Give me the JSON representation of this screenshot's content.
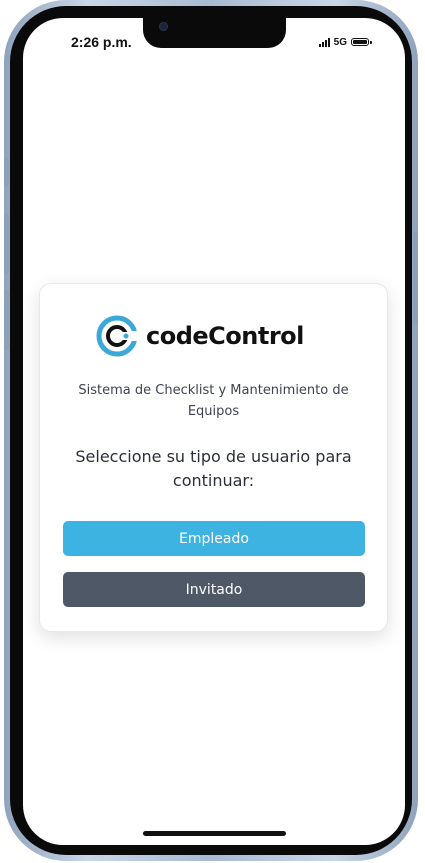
{
  "status_bar": {
    "time": "2:26 p.m.",
    "network": "5G",
    "icons": [
      "signal-icon",
      "battery-icon"
    ]
  },
  "app": {
    "logo_text": "codeControl",
    "subtitle": "Sistema de Checklist y Mantenimiento de Equipos",
    "prompt": "Seleccione su tipo de usuario para continuar:",
    "buttons": {
      "employee_label": "Empleado",
      "guest_label": "Invitado"
    }
  },
  "colors": {
    "brand_blue": "#3cb3e0",
    "employee_button": "#3cb3e0",
    "guest_button": "#4f5866",
    "phone_frame": "#a9bbd1"
  }
}
